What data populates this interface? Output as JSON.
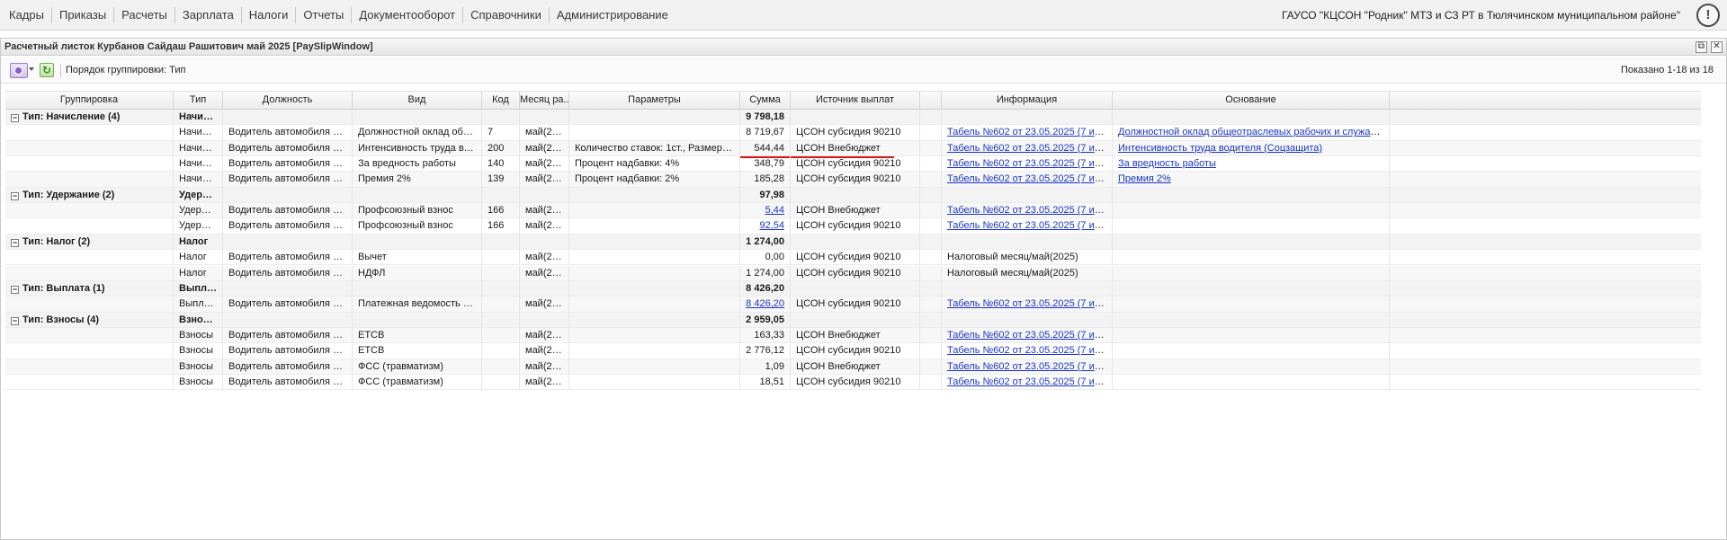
{
  "menu": {
    "items": [
      "Кадры",
      "Приказы",
      "Расчеты",
      "Зарплата",
      "Налоги",
      "Отчеты",
      "Документооборот",
      "Справочники",
      "Администрирование"
    ],
    "organization": "ГАУСО \"КЦСОН \"Родник\" МТЗ и СЗ РТ в Тюлячинском муниципальном районе\"",
    "alert_symbol": "!"
  },
  "window": {
    "title": "Расчетный листок Курбанов Сайдаш Рашитович май 2025 [PaySlipWindow]",
    "restore_symbol": "⧉",
    "close_symbol": "✕"
  },
  "toolbar": {
    "grouping_label": "Порядок группировки:",
    "grouping_value": "Тип",
    "shown": "Показано 1-18 из 18",
    "refresh_symbol": "↻"
  },
  "columns": {
    "group": "Группировка",
    "type": "Тип",
    "position": "Должность",
    "kind": "Вид",
    "code": "Код",
    "month": "Месяц ра...",
    "params": "Параметры",
    "sum": "Сумма",
    "source": "Источник выплат",
    "blank": "",
    "info": "Информация",
    "basis": "Основание"
  },
  "rows": [
    {
      "group": true,
      "label": "Тип: Начисление (4)",
      "type": "Начисл...",
      "sum": "9 798,18"
    },
    {
      "type": "Начислен...",
      "position": "Водитель автомобиля 9-10 раз...",
      "kind": "Должностной оклад общеотра...",
      "code": "7",
      "month": "май(2025)",
      "params": "",
      "sum": "8 719,67",
      "source": "ЦСОН субсидия 90210",
      "info": "Табель №602 от 23.05.2025 (7 из 18 дн;...",
      "basis": "Должностной оклад общеотраслевых рабочих и служащих"
    },
    {
      "type": "Начислен...",
      "position": "Водитель автомобиля 9-10 раз...",
      "kind": "Интенсивность труда водител...",
      "code": "200",
      "month": "май(2025)",
      "params": "Количество ставок: 1ст., Размер надбавк...",
      "sum": "544,44",
      "source": "ЦСОН Внебюджет",
      "info": "Табель №602 от 23.05.2025 (7 из 18 дн;...",
      "basis": "Интенсивность труда водителя (Соцзащита)"
    },
    {
      "type": "Начислен...",
      "position": "Водитель автомобиля 9-10 раз...",
      "kind": "За вредность работы",
      "code": "140",
      "month": "май(2025)",
      "params": "Процент надбавки: 4%",
      "sum": "348,79",
      "source": "ЦСОН субсидия 90210",
      "info": "Табель №602 от 23.05.2025 (7 из 18 дн;...",
      "basis": "За вредность работы"
    },
    {
      "type": "Начислен...",
      "position": "Водитель автомобиля 9-10 раз...",
      "kind": "Премия 2%",
      "code": "139",
      "month": "май(2025)",
      "params": "Процент надбавки: 2%",
      "sum": "185,28",
      "source": "ЦСОН субсидия 90210",
      "info": "Табель №602 от 23.05.2025 (7 из 18 дн;...",
      "basis": "Премия 2%"
    },
    {
      "group": true,
      "label": "Тип: Удержание (2)",
      "type": "Удержа...",
      "sum": "97,98"
    },
    {
      "type": "Удержание",
      "position": "Водитель автомобиля 9-10 раз...",
      "kind": "Профсоюзный взнос",
      "code": "166",
      "month": "май(2025)",
      "params": "",
      "sum": "5,44",
      "sum_link": true,
      "source": "ЦСОН Внебюджет",
      "info": "Табель №602 от 23.05.2025 (7 из 18 дн;...",
      "basis": ""
    },
    {
      "type": "Удержание",
      "position": "Водитель автомобиля 9-10 раз...",
      "kind": "Профсоюзный взнос",
      "code": "166",
      "month": "май(2025)",
      "params": "",
      "sum": "92,54",
      "sum_link": true,
      "source": "ЦСОН субсидия 90210",
      "info": "Табель №602 от 23.05.2025 (7 из 18 дн;...",
      "basis": ""
    },
    {
      "group": true,
      "label": "Тип: Налог (2)",
      "type": "Налог",
      "sum": "1 274,00"
    },
    {
      "type": "Налог",
      "position": "Водитель автомобиля 9-10 раз...",
      "kind": "Вычет",
      "code": "",
      "month": "май(2025)",
      "params": "",
      "sum": "0,00",
      "source": "ЦСОН субсидия 90210",
      "info": "Налоговый месяц/май(2025)",
      "info_plain": true,
      "basis": ""
    },
    {
      "type": "Налог",
      "position": "Водитель автомобиля 9-10 раз...",
      "kind": "НДФЛ",
      "code": "",
      "month": "май(2025)",
      "params": "",
      "sum": "1 274,00",
      "source": "ЦСОН субсидия 90210",
      "info": "Налоговый месяц/май(2025)",
      "info_plain": true,
      "basis": ""
    },
    {
      "group": true,
      "label": "Тип: Выплата (1)",
      "type": "Выплата",
      "sum": "8 426,20"
    },
    {
      "type": "Выплата",
      "position": "Водитель автомобиля 9-10 раз...",
      "kind": "Платежная ведомость №78 от...",
      "code": "",
      "month": "май(2025)",
      "params": "",
      "sum": "8 426,20",
      "sum_link": true,
      "source": "ЦСОН субсидия 90210",
      "info": "Табель №602 от 23.05.2025 (7 из 18 дн;...",
      "basis": ""
    },
    {
      "group": true,
      "label": "Тип: Взносы (4)",
      "type": "Взносы",
      "sum": "2 959,05"
    },
    {
      "type": "Взносы",
      "position": "Водитель автомобиля 9-10 раз...",
      "kind": "ЕТСВ",
      "code": "",
      "month": "май(2025)",
      "params": "",
      "sum": "163,33",
      "source": "ЦСОН Внебюджет",
      "info": "Табель №602 от 23.05.2025 (7 из 18 дн;...",
      "basis": ""
    },
    {
      "type": "Взносы",
      "position": "Водитель автомобиля 9-10 раз...",
      "kind": "ЕТСВ",
      "code": "",
      "month": "май(2025)",
      "params": "",
      "sum": "2 776,12",
      "source": "ЦСОН субсидия 90210",
      "info": "Табель №602 от 23.05.2025 (7 из 18 дн;...",
      "basis": ""
    },
    {
      "type": "Взносы",
      "position": "Водитель автомобиля 9-10 раз...",
      "kind": "ФСС (травматизм)",
      "code": "",
      "month": "май(2025)",
      "params": "",
      "sum": "1,09",
      "source": "ЦСОН Внебюджет",
      "info": "Табель №602 от 23.05.2025 (7 из 18 дн;...",
      "basis": ""
    },
    {
      "type": "Взносы",
      "position": "Водитель автомобиля 9-10 раз...",
      "kind": "ФСС (травматизм)",
      "code": "",
      "month": "май(2025)",
      "params": "",
      "sum": "18,51",
      "source": "ЦСОН субсидия 90210",
      "info": "Табель №602 от 23.05.2025 (7 из 18 дн;...",
      "basis": ""
    }
  ],
  "expander_symbol": "−"
}
